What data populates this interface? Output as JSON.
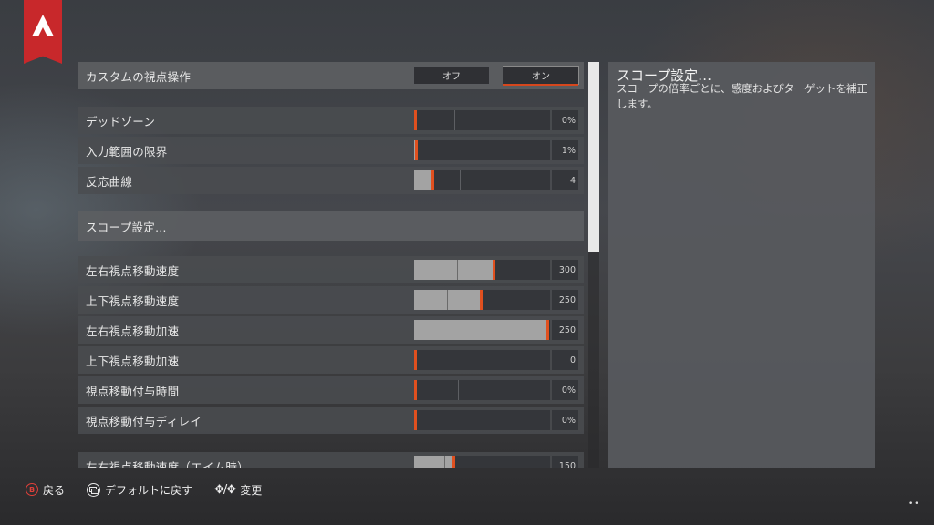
{
  "logo": {
    "name": "apex-legends-logo",
    "color": "#c8282b"
  },
  "rows": {
    "custom_look": {
      "label": "カスタムの視点操作",
      "options": [
        "オフ",
        "オン"
      ],
      "selected": "オン"
    },
    "deadzone": {
      "label": "デッドゾーン",
      "value": "0%",
      "level": 0.0
    },
    "outer_threshold": {
      "label": "入力範囲の限界",
      "value": "1%",
      "level": 0.01
    },
    "response_curve": {
      "label": "反応曲線",
      "value": "4",
      "level": 0.13
    },
    "scope_settings": {
      "label": "スコープ設定…"
    },
    "yaw_speed": {
      "label": "左右視点移動速度",
      "value": "300",
      "level": 0.59
    },
    "pitch_speed": {
      "label": "上下視点移動速度",
      "value": "250",
      "level": 0.49
    },
    "turning_extra_yaw": {
      "label": "左右視点移動加速",
      "value": "250",
      "level": 0.99
    },
    "turning_extra_pitch": {
      "label": "上下視点移動加速",
      "value": "0",
      "level": 0.0
    },
    "ramp_up_time": {
      "label": "視点移動付与時間",
      "value": "0%",
      "level": 0.0
    },
    "ramp_up_delay": {
      "label": "視点移動付与ディレイ",
      "value": "0%",
      "level": 0.0
    },
    "ads_yaw_speed": {
      "label": "左右視点移動速度（エイム時）",
      "value": "150",
      "level": 0.29
    }
  },
  "description": {
    "title": "スコープ設定…",
    "text": "スコープの倍率ごとに、感度およびターゲットを補正します。"
  },
  "footer": {
    "back_label": "戻る",
    "back_button": "B",
    "default_label": "デフォルトに戻す",
    "change_label": "変更",
    "change_glyph": "✥/✥"
  },
  "corner_text": "••",
  "accent_color": "#e0501f"
}
